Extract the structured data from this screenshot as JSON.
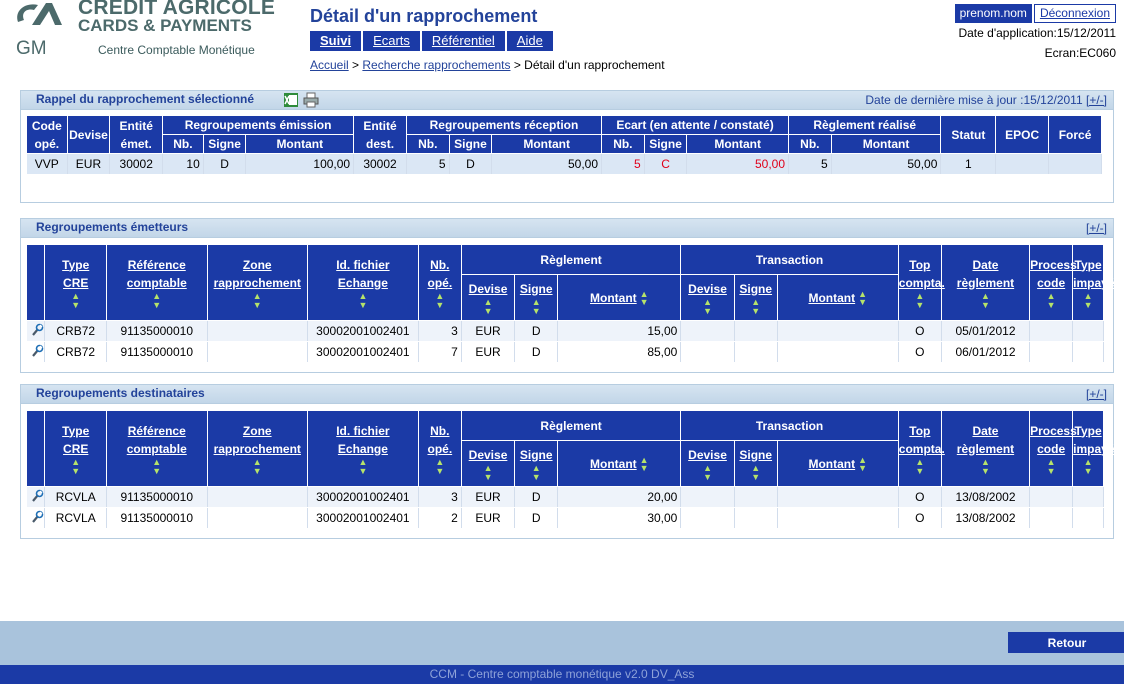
{
  "brand": {
    "line1": "CRÉDIT AGRICOLE",
    "line2": "CARDS & PAYMENTS",
    "gm": "GM",
    "subtitle": "Centre Comptable Monétique"
  },
  "page": {
    "title": "Détail d'un rapprochement"
  },
  "menu": [
    {
      "label": "Suivi",
      "active": true
    },
    {
      "label": "Ecarts",
      "active": false
    },
    {
      "label": "Référentiel",
      "active": false
    },
    {
      "label": "Aide",
      "active": false
    }
  ],
  "breadcrumb": {
    "home": "Accueil",
    "search": "Recherche rapprochements",
    "separator1": ">",
    "separator2": ">",
    "current": "Détail d'un rapprochement"
  },
  "user": {
    "name": "prenom.nom",
    "logout": "Déconnexion",
    "app_date": "Date d'application:15/12/2011",
    "screen": "Ecran:EC060"
  },
  "summary": {
    "title": "Rappel du rapprochement sélectionné",
    "update_text": "Date de dernière mise à jour :15/12/2011",
    "toggle": "[+/-]",
    "headers": {
      "code_ope": "Code opé.",
      "devise": "Devise",
      "entite_emet": "Entité émet.",
      "regroup_emission": "Regroupements émission",
      "entite_dest": "Entité dest.",
      "regroup_reception": "Regroupements réception",
      "ecart": "Ecart (en attente / constaté)",
      "reglement_realise": "Règlement réalisé",
      "statut": "Statut",
      "epoc": "EPOC",
      "force": "Forcé",
      "nb": "Nb.",
      "signe": "Signe",
      "montant": "Montant"
    },
    "row": {
      "code_ope": "VVP",
      "devise": "EUR",
      "entite_emet": "30002",
      "em_nb": "10",
      "em_signe": "D",
      "em_montant": "100,00",
      "entite_dest": "30002",
      "rec_nb": "5",
      "rec_signe": "D",
      "rec_montant": "50,00",
      "ec_nb": "5",
      "ec_signe": "C",
      "ec_montant": "50,00",
      "reg_nb": "5",
      "reg_montant": "50,00",
      "statut": "1",
      "epoc": "",
      "force": ""
    }
  },
  "group_headers": {
    "type": "Type",
    "cre": "CRE",
    "reference": "Référence",
    "comptable": "comptable",
    "zone": "Zone",
    "rapprochement": "rapprochement",
    "id_fichier": "Id. fichier",
    "echange": "Echange",
    "nb": "Nb.",
    "ope": "opé.",
    "reglement": "Règlement",
    "transaction": "Transaction",
    "devise": "Devise",
    "signe": "Signe",
    "montant": "Montant",
    "top": "Top",
    "compta": "compta.",
    "date": "Date",
    "date_reglement": "règlement",
    "process": "Process",
    "code": "code",
    "type_impaye": "Type",
    "impaye": "impayé"
  },
  "emetteurs": {
    "title": "Regroupements émetteurs",
    "toggle": "[+/-]",
    "rows": [
      {
        "type": "CRB72",
        "reference": "91135000010",
        "zone": "",
        "id_fichier": "30002001002401",
        "nb": "3",
        "reg_devise": "EUR",
        "reg_signe": "D",
        "reg_montant": "15,00",
        "tr_devise": "",
        "tr_signe": "",
        "tr_montant": "",
        "top": "O",
        "date": "05/01/2012",
        "process": "",
        "impaye": ""
      },
      {
        "type": "CRB72",
        "reference": "91135000010",
        "zone": "",
        "id_fichier": "30002001002401",
        "nb": "7",
        "reg_devise": "EUR",
        "reg_signe": "D",
        "reg_montant": "85,00",
        "tr_devise": "",
        "tr_signe": "",
        "tr_montant": "",
        "top": "O",
        "date": "06/01/2012",
        "process": "",
        "impaye": ""
      }
    ]
  },
  "destinataires": {
    "title": "Regroupements destinataires",
    "toggle": "[+/-]",
    "rows": [
      {
        "type": "RCVLA",
        "reference": "91135000010",
        "zone": "",
        "id_fichier": "30002001002401",
        "nb": "3",
        "reg_devise": "EUR",
        "reg_signe": "D",
        "reg_montant": "20,00",
        "tr_devise": "",
        "tr_signe": "",
        "tr_montant": "",
        "top": "O",
        "date": "13/08/2002",
        "process": "",
        "impaye": ""
      },
      {
        "type": "RCVLA",
        "reference": "91135000010",
        "zone": "",
        "id_fichier": "30002001002401",
        "nb": "2",
        "reg_devise": "EUR",
        "reg_signe": "D",
        "reg_montant": "30,00",
        "tr_devise": "",
        "tr_signe": "",
        "tr_montant": "",
        "top": "O",
        "date": "13/08/2002",
        "process": "",
        "impaye": ""
      }
    ]
  },
  "footer": {
    "retour": "Retour",
    "status": "CCM - Centre comptable monétique v2.0 DV_Ass"
  },
  "colors": {
    "primary": "#1b3aa6",
    "panel_head": "#c2d6e8",
    "brand_text": "#4c6a6b",
    "sort_arrows": "#b6e36a",
    "ecart_red": "#e0001a"
  }
}
